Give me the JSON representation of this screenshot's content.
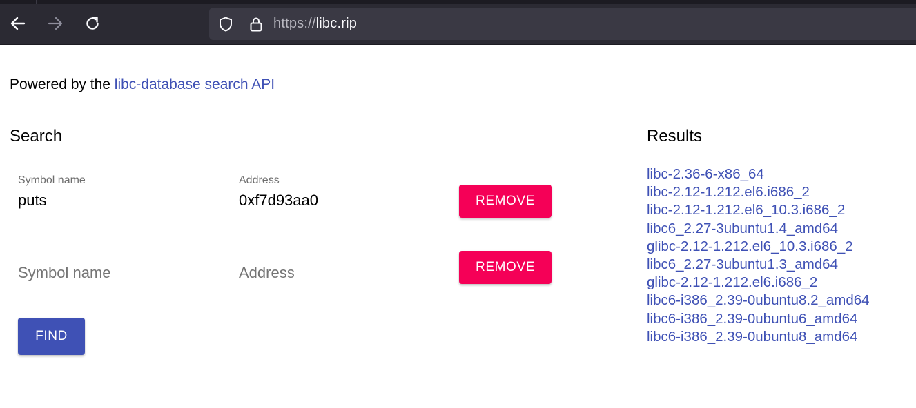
{
  "browser": {
    "url_scheme": "https://",
    "url_host": "libc.rip",
    "icons": {
      "back": "arrow-left-icon",
      "forward": "arrow-right-icon",
      "reload": "reload-icon",
      "tracking": "shield-icon",
      "security": "lock-icon"
    }
  },
  "page": {
    "powered_prefix": "Powered by the",
    "powered_link": "libc-database search API",
    "search_heading": "Search",
    "results_heading": "Results"
  },
  "search": {
    "rows": [
      {
        "symbol_label": "Symbol name",
        "symbol_value": "puts",
        "address_label": "Address",
        "address_value": "0xf7d93aa0",
        "remove_label": "REMOVE"
      },
      {
        "symbol_placeholder": "Symbol name",
        "address_placeholder": "Address",
        "remove_label": "REMOVE"
      }
    ],
    "find_label": "FIND"
  },
  "results": [
    "libc-2.36-6-x86_64",
    "libc-2.12-1.212.el6.i686_2",
    "libc-2.12-1.212.el6_10.3.i686_2",
    "libc6_2.27-3ubuntu1.4_amd64",
    "glibc-2.12-1.212.el6_10.3.i686_2",
    "libc6_2.27-3ubuntu1.3_amd64",
    "glibc-2.12-1.212.el6.i686_2",
    "libc6-i386_2.39-0ubuntu8.2_amd64",
    "libc6-i386_2.39-0ubuntu6_amd64",
    "libc6-i386_2.39-0ubuntu8_amd64"
  ],
  "colors": {
    "primary": "#3f51b5",
    "secondary": "#f50057",
    "chrome": "#2b2a33"
  }
}
